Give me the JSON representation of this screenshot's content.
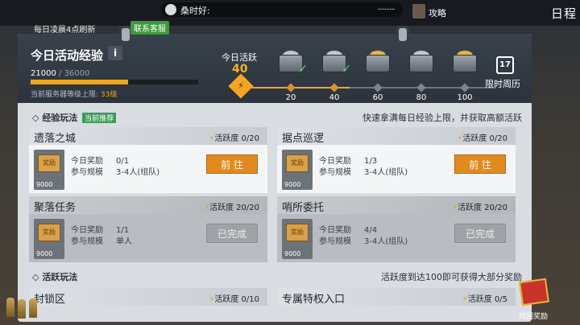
{
  "top_bar": {
    "refresh_note": "每日凌晨4点刷新",
    "support_label": "联系客服",
    "chat_message": "桑时好:",
    "chat_dots": "..........",
    "strategy_label": "攻略",
    "page_title": "日程"
  },
  "exp": {
    "title": "今日活动经验",
    "info_label": "i",
    "current": "21000",
    "max": "/ 36000",
    "progress": 0.583,
    "server_cap_prefix": "当前服务器等级上限:",
    "server_cap_level": "33级"
  },
  "activity": {
    "label": "今日活跃",
    "value": "40",
    "progress": 0.4,
    "milestones": [
      {
        "value": "20",
        "claimed": true,
        "chest": "silver"
      },
      {
        "value": "40",
        "claimed": true,
        "chest": "silver"
      },
      {
        "value": "60",
        "claimed": false,
        "chest": "gold"
      },
      {
        "value": "80",
        "claimed": false,
        "chest": "steel"
      },
      {
        "value": "100",
        "claimed": false,
        "chest": "gold"
      }
    ],
    "calendar_day": "17",
    "calendar_label": "限时周历"
  },
  "section1": {
    "title": "经验玩法",
    "tag": "当前推荐",
    "tip": "快速拿满每日经验上限，并获取高额活跃"
  },
  "section2": {
    "title": "活跃玩法",
    "tip": "活跃度到达100即可获得大部分奖励"
  },
  "labels": {
    "reward": "今日奖励",
    "scale": "参与规模",
    "activity": "活跃度",
    "go": "前 往",
    "done": "已完成",
    "ticket_text": "奖励",
    "ticket_value": "9000"
  },
  "cards": [
    {
      "name": "遗落之城",
      "act": "0/20",
      "reward": "0/1",
      "scale": "3-4人(组队)",
      "status": "go"
    },
    {
      "name": "据点巡逻",
      "act": "0/20",
      "reward": "1/3",
      "scale": "3-4人(组队)",
      "status": "go"
    },
    {
      "name": "聚落任务",
      "act": "20/20",
      "reward": "1/1",
      "scale": "单人",
      "status": "done"
    },
    {
      "name": "哨所委托",
      "act": "20/20",
      "reward": "4/4",
      "scale": "3-4人(组队)",
      "status": "done"
    }
  ],
  "small_cards": [
    {
      "name": "封锁区",
      "act": "0/10"
    },
    {
      "name": "专属特权入口",
      "act": "0/5"
    }
  ],
  "gift_label": "找回奖励"
}
